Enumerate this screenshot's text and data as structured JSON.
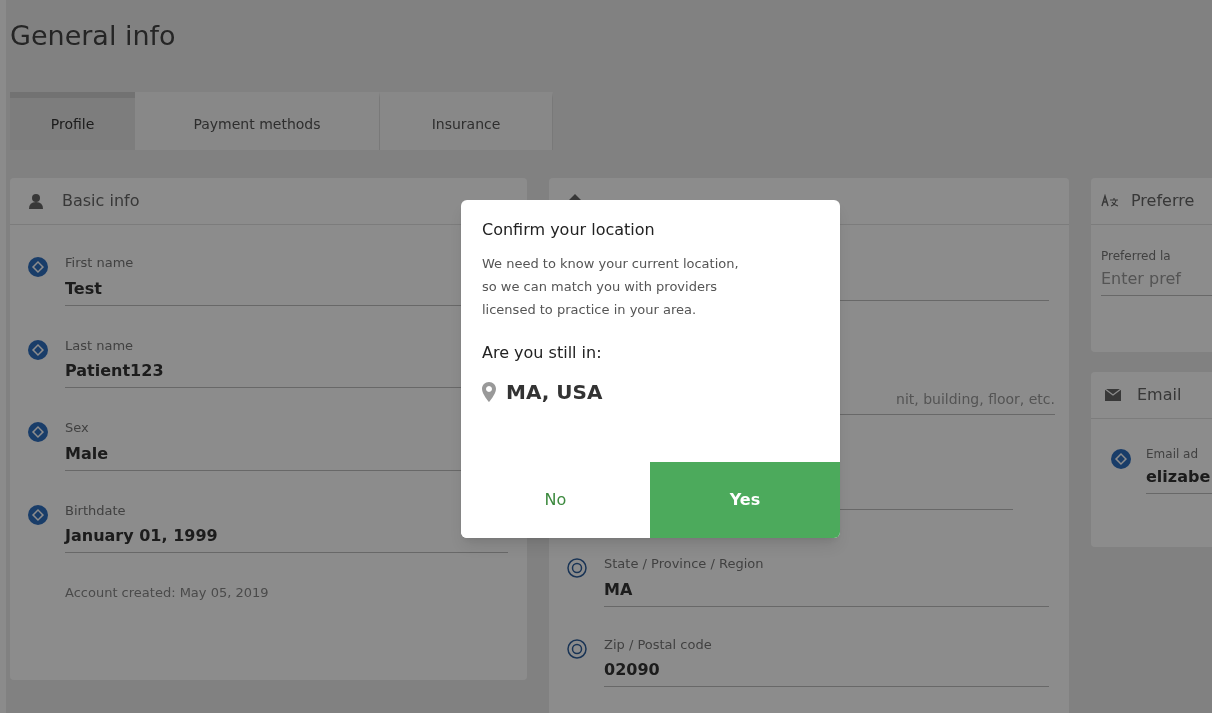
{
  "page_title": "General info",
  "tabs": [
    {
      "label": "Profile",
      "selected": true
    },
    {
      "label": "Payment methods",
      "selected": false
    },
    {
      "label": "Insurance",
      "selected": false
    }
  ],
  "basic_info": {
    "title": "Basic info",
    "fields": [
      {
        "label": "First name",
        "value": "Test"
      },
      {
        "label": "Last name",
        "value": "Patient123"
      },
      {
        "label": "Sex",
        "value": "Male"
      },
      {
        "label": "Birthdate",
        "value": "January 01, 1999"
      }
    ],
    "footer": "Account created: May 05, 2019"
  },
  "home_address": {
    "address_line_placeholder": "nit, building, floor, etc.",
    "fields": [
      {
        "label": "State / Province / Region",
        "value": "MA"
      },
      {
        "label": "Zip / Postal code",
        "value": "02090"
      }
    ]
  },
  "preferences": {
    "title": "Preferre",
    "label": "Preferred la",
    "placeholder": "Enter pref"
  },
  "email": {
    "title": "Email",
    "label": "Email ad",
    "value": "elizabe"
  },
  "dialog": {
    "title": "Confirm your location",
    "message": "We need to know your current location, so we can match you with providers licensed to practice in your area.",
    "question": "Are you still in:",
    "location": "MA, USA",
    "buttons": [
      {
        "label": "No",
        "kind": "secondary"
      },
      {
        "label": "Yes",
        "kind": "primary"
      }
    ]
  }
}
